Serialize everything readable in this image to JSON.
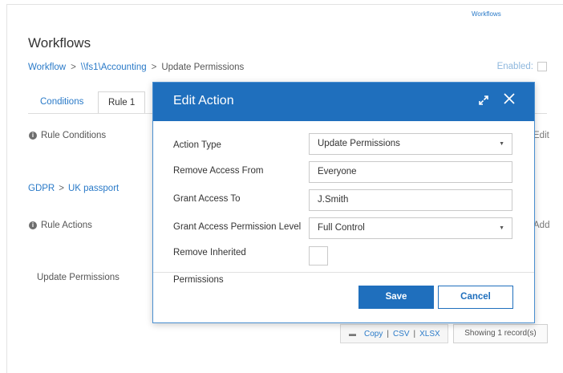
{
  "top_link": "Workflows",
  "page_title": "Workflows",
  "breadcrumb": {
    "items": [
      "Workflow",
      "\\\\fs1\\Accounting",
      "Update Permissions"
    ],
    "sep": ">"
  },
  "enabled_label": "Enabled:",
  "tabs": [
    {
      "label": "Conditions"
    },
    {
      "label": "Rule 1"
    }
  ],
  "rule_conditions_label": "Rule Conditions",
  "edit_label": "Edit",
  "gdpr": {
    "parts": [
      "GDPR",
      "UK passport"
    ],
    "sep": ">"
  },
  "rule_actions_label": "Rule Actions",
  "add_label": "Add",
  "action_row": "Update Permissions",
  "export": {
    "copy": "Copy",
    "csv": "CSV",
    "xlsx": "XLSX",
    "sep": "|"
  },
  "records_label": "Showing 1 record(s)",
  "modal": {
    "title": "Edit Action",
    "fields": {
      "action_type": {
        "label": "Action Type",
        "value": "Update Permissions"
      },
      "remove_access_from": {
        "label": "Remove Access From",
        "value": "Everyone"
      },
      "grant_access_to": {
        "label": "Grant Access To",
        "value": "J.Smith"
      },
      "grant_level": {
        "label": "Grant Access Permission Level",
        "value": "Full Control"
      },
      "remove_inherited": {
        "label_line1": "Remove Inherited",
        "label_line2": "Permissions",
        "checked": false
      }
    },
    "save_label": "Save",
    "cancel_label": "Cancel"
  }
}
